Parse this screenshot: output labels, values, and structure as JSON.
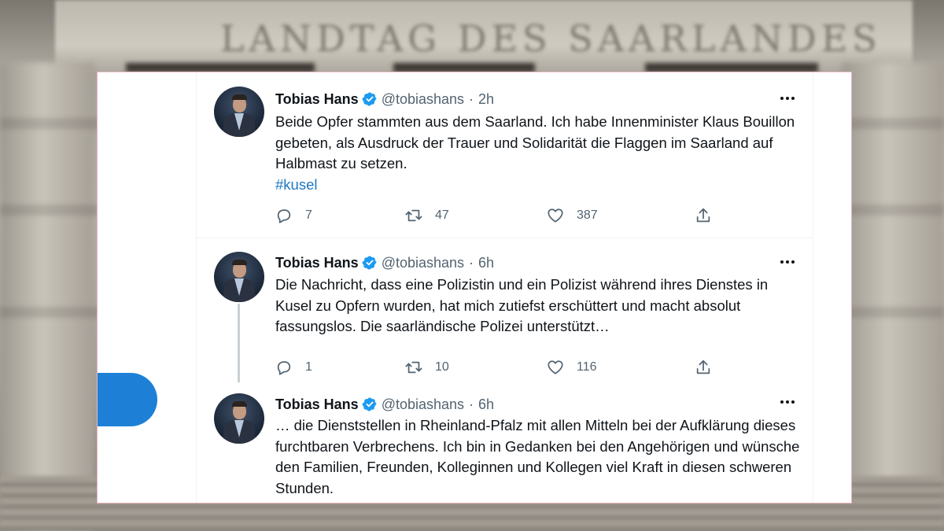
{
  "background": {
    "building_inscription": "LANDTAG DES SAARLANDES"
  },
  "colors": {
    "link": "#1d77c2",
    "verified": "#1d9bf0",
    "primary_button": "#1d80d6",
    "secondary_text": "#536471"
  },
  "tweets": [
    {
      "name": "Tobias Hans",
      "handle": "@tobiashans",
      "separator": "·",
      "time": "2h",
      "text": "Beide Opfer stammten aus dem Saarland. Ich habe Innenminister Klaus Bouillon gebeten, als Ausdruck der Trauer und Solidarität die Flaggen im Saarland auf Halbmast zu setzen.",
      "hashtag": "#kusel",
      "replies": "7",
      "retweets": "47",
      "likes": "387"
    },
    {
      "name": "Tobias Hans",
      "handle": "@tobiashans",
      "separator": "·",
      "time": "6h",
      "text": "Die Nachricht, dass eine Polizistin und ein Polizist während ihres Dienstes in Kusel zu Opfern wurden, hat mich zutiefst erschüttert und macht absolut fassungslos. Die saarländische Polizei unterstützt…",
      "replies": "1",
      "retweets": "10",
      "likes": "116"
    },
    {
      "name": "Tobias Hans",
      "handle": "@tobiashans",
      "separator": "·",
      "time": "6h",
      "text": "… die Dienststellen in Rheinland-Pfalz mit allen Mitteln bei der Aufklärung dieses furchtbaren Verbrechens. Ich bin in Gedanken bei den Angehörigen und wünsche den Familien, Freunden, Kolleginnen und Kollegen viel Kraft in diesen schweren Stunden."
    }
  ],
  "icons": {
    "verified": "verified-badge-icon",
    "more": "more-options-icon",
    "reply": "reply-icon",
    "retweet": "retweet-icon",
    "like": "heart-icon",
    "share": "share-icon"
  }
}
